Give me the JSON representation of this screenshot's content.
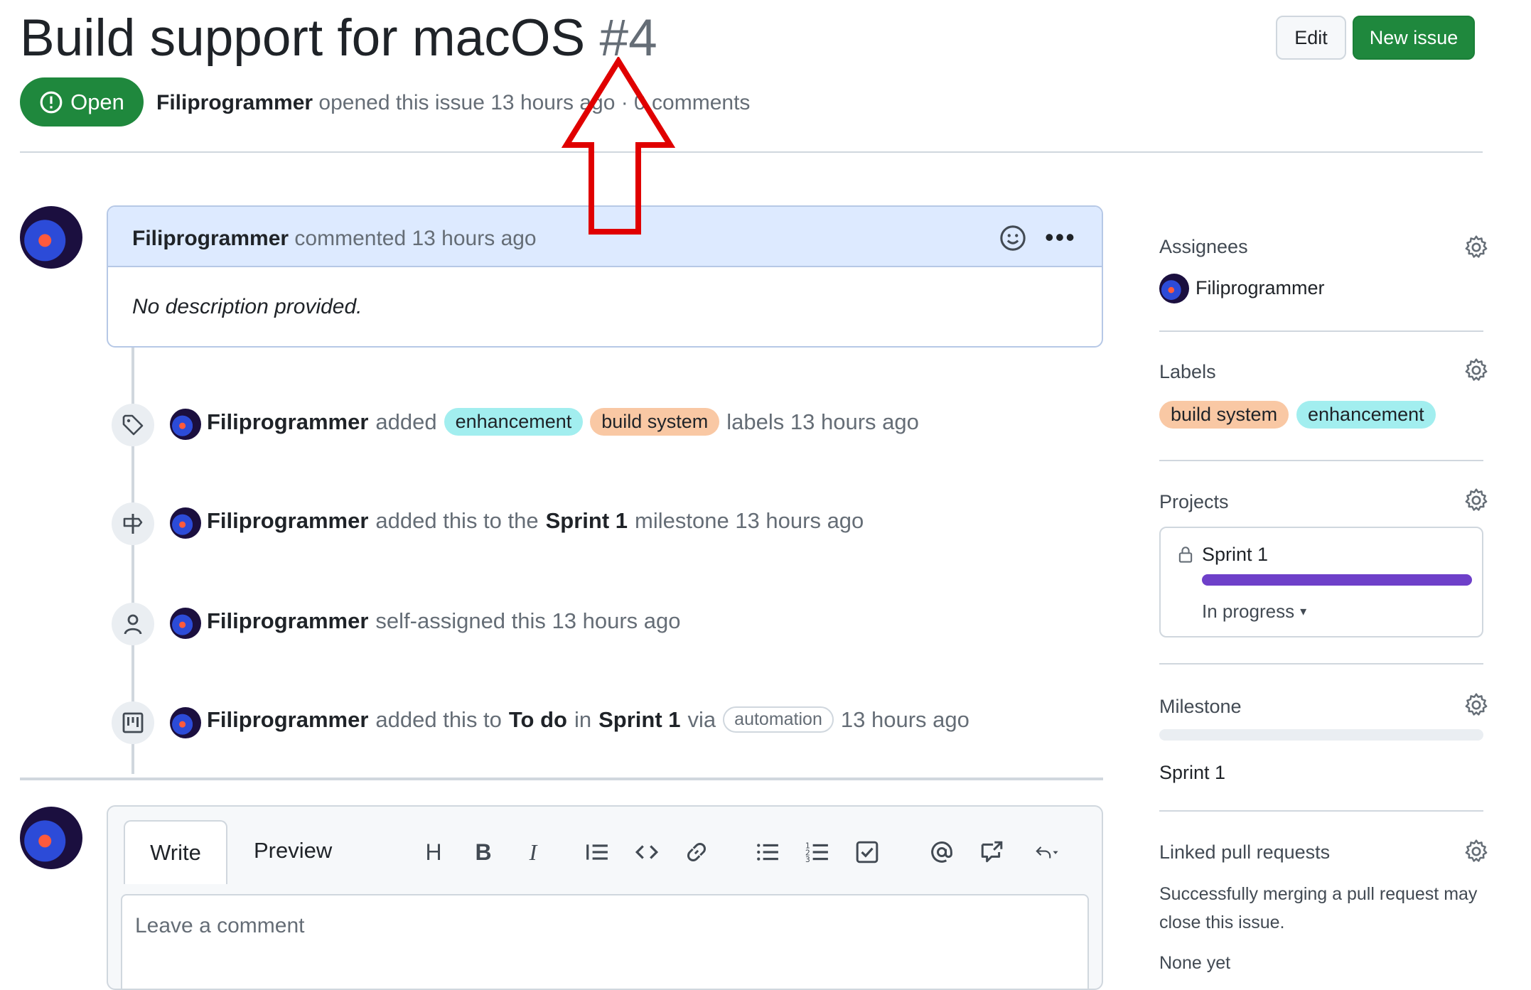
{
  "issue": {
    "title": "Build support for macOS",
    "number": "#4",
    "state": "Open",
    "author": "Filiprogrammer",
    "meta_rest": "opened this issue 13 hours ago · 0 comments"
  },
  "header_buttons": {
    "edit": "Edit",
    "new_issue": "New issue"
  },
  "comment": {
    "author": "Filiprogrammer",
    "action": "commented 13 hours ago",
    "body": "No description provided."
  },
  "timeline": [
    {
      "icon": "tag-icon",
      "actor": "Filiprogrammer",
      "pre": "added",
      "labels": [
        "enhancement",
        "build system"
      ],
      "post": "labels 13 hours ago"
    },
    {
      "icon": "milestone-icon",
      "actor": "Filiprogrammer",
      "pre": "added this to the",
      "bold": "Sprint 1",
      "post": "milestone 13 hours ago"
    },
    {
      "icon": "person-icon",
      "actor": "Filiprogrammer",
      "pre": "self-assigned this 13 hours ago"
    },
    {
      "icon": "project-icon",
      "actor": "Filiprogrammer",
      "pre": "added this to",
      "bold1": "To do",
      "mid": "in",
      "bold2": "Sprint 1",
      "via": "via",
      "badge": "automation",
      "post": "13 hours ago"
    }
  ],
  "editor": {
    "tabs": [
      "Write",
      "Preview"
    ],
    "placeholder": "Leave a comment",
    "toolbar": [
      "heading-icon",
      "bold-icon",
      "italic-icon",
      "quote-icon",
      "code-icon",
      "link-icon",
      "bulleted-list-icon",
      "numbered-list-icon",
      "task-list-icon",
      "mention-icon",
      "cross-reference-icon",
      "reply-icon"
    ]
  },
  "sidebar": {
    "assignees": {
      "heading": "Assignees",
      "user": "Filiprogrammer"
    },
    "labels": {
      "heading": "Labels",
      "items": [
        "build system",
        "enhancement"
      ]
    },
    "projects": {
      "heading": "Projects",
      "name": "Sprint 1",
      "status": "In progress",
      "progress": 1.0
    },
    "milestone": {
      "heading": "Milestone",
      "name": "Sprint 1",
      "progress": 0.0
    },
    "linked_prs": {
      "heading": "Linked pull requests",
      "description": "Successfully merging a pull request may close this issue.",
      "empty": "None yet"
    }
  },
  "colors": {
    "open_green": "#1f883d",
    "label_enhancement": "#a2eeef",
    "label_build_system": "#f9c8a4",
    "project_progress": "#6e40c9",
    "annotation_arrow": "#e00000"
  }
}
